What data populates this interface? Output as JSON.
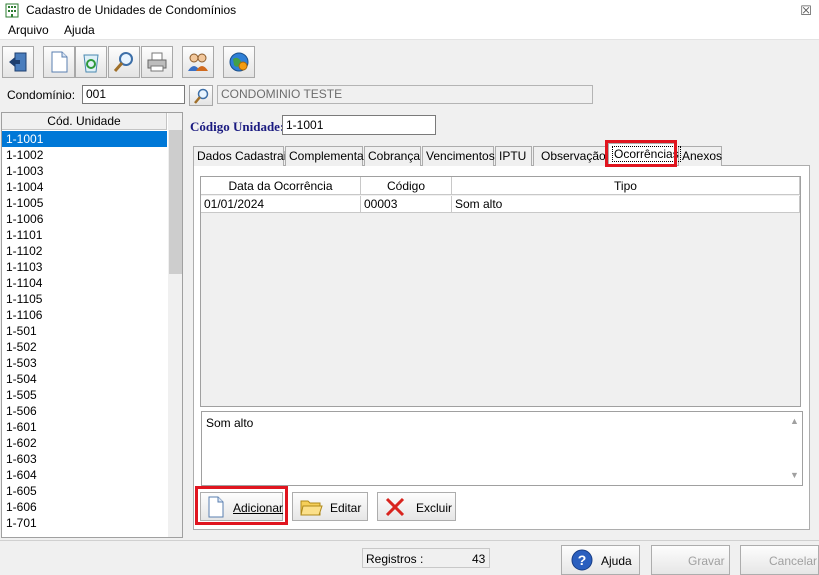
{
  "window": {
    "title": "Cadastro de Unidades de Condomínios",
    "close_glyph": "☒"
  },
  "menu": [
    "Arquivo",
    "Ajuda"
  ],
  "toolbar": {
    "icons": [
      "exit-icon",
      "new-document-icon",
      "refresh-recycle-icon",
      "search-icon",
      "print-icon",
      "users-icon",
      "settings-globe-icon"
    ]
  },
  "condominio": {
    "label": "Condomínio:",
    "code": "001",
    "name": "CONDOMINIO TESTE"
  },
  "unit_list": {
    "header": "Cód. Unidade",
    "items": [
      "1-1001",
      "1-1002",
      "1-1003",
      "1-1004",
      "1-1005",
      "1-1006",
      "1-1101",
      "1-1102",
      "1-1103",
      "1-1104",
      "1-1105",
      "1-1106",
      "1-501",
      "1-502",
      "1-503",
      "1-504",
      "1-505",
      "1-506",
      "1-601",
      "1-602",
      "1-603",
      "1-604",
      "1-605",
      "1-606",
      "1-701"
    ],
    "selected": "1-1001"
  },
  "codigo_unidade": {
    "label": "Código Unidade:",
    "value": "1-1001"
  },
  "tabs": [
    "Dados Cadastrais",
    "Complementar",
    "Cobrança",
    "Vencimentos",
    "IPTU",
    "Observação",
    "Ocorrências",
    "Anexos"
  ],
  "active_tab": "Ocorrências",
  "grid": {
    "columns": [
      "Data da Ocorrência",
      "Código",
      "Tipo"
    ],
    "rows": [
      [
        "01/01/2024",
        "00003",
        "Som alto"
      ]
    ]
  },
  "memo": {
    "text": "Som alto"
  },
  "panel_buttons": {
    "add": "Adicionar",
    "edit": "Editar",
    "delete": "Excluir"
  },
  "status": {
    "registros_label": "Registros :",
    "registros_count": "43"
  },
  "bottom_buttons": {
    "help": "Ajuda",
    "save": "Gravar",
    "cancel": "Cancelar"
  },
  "colors": {
    "selection": "#0078d7",
    "highlight": "#e0151f",
    "label_blue": "#1a1a80"
  }
}
